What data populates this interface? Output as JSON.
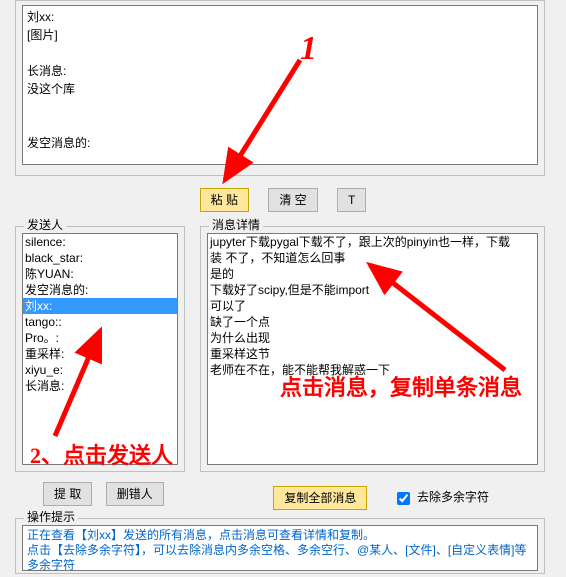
{
  "top_text": "刘xx:\n[图片]\n\n长消息:\n没这个库\n\n\n发空消息的:",
  "buttons": {
    "paste": "粘 贴",
    "clear": "清 空",
    "t": "T",
    "extract": "提 取",
    "del_wrong": "删错人",
    "copy_all": "复制全部消息"
  },
  "sender": {
    "title": "发送人",
    "items": [
      "silence:",
      "black_star:",
      "陈YUAN:",
      "发空消息的:",
      "刘xx:",
      "tango::",
      "Pro。:",
      "重采样:",
      "xiyu_e:",
      "长消息:"
    ],
    "selected_index": 4
  },
  "detail": {
    "title": "消息详情",
    "items": [
      "jupyter下载pygal下载不了，跟上次的pinyin也一样，下载",
      "装 不了，不知道怎么回事",
      "是的",
      "下载好了scipy,但是不能import",
      "可以了",
      "缺了一个点",
      "为什么出现",
      "重采样这节",
      "老师在不在，能不能帮我解惑一下"
    ]
  },
  "remove_extra": {
    "label": "去除多余字符",
    "checked": true
  },
  "hint": {
    "title": "操作提示",
    "line1": "正在查看【刘xx】发送的所有消息，点击消息可查看详情和复制。",
    "line2": "点击【去除多余字符】，可以去除消息内多余空格、多余空行、@某人、[文件]、[自定义表情]等多余字符"
  },
  "annotations": {
    "one": "1",
    "two": "2、点击发送人",
    "click_msg": "点击消息，复制单条消息"
  }
}
